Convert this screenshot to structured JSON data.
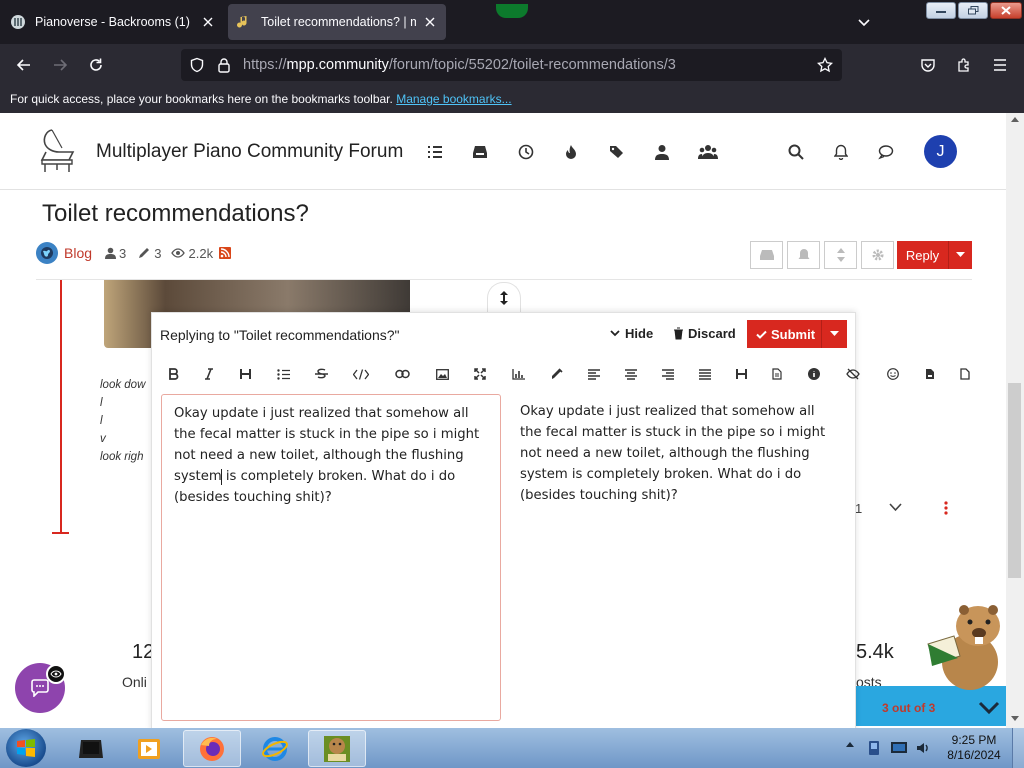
{
  "browser": {
    "tabs": [
      {
        "title": "Pianoverse - Backrooms (1)",
        "active": false
      },
      {
        "title": "Toilet recommendations? | mpp",
        "active": true
      }
    ],
    "url_prefix": "https://",
    "url_domain": "mpp.community",
    "url_path": "/forum/topic/55202/toilet-recommendations/3",
    "bookmark_hint": "For quick access, place your bookmarks here on the bookmarks toolbar.",
    "bookmark_link": "Manage bookmarks..."
  },
  "forum": {
    "site_name": "Multiplayer Piano Community Forum",
    "avatar_letter": "J",
    "nav_icons": [
      "list-icon",
      "inbox-icon",
      "clock-icon",
      "fire-icon",
      "tags-icon",
      "user-icon",
      "users-icon"
    ],
    "right_icons": [
      "search-icon",
      "bell-icon",
      "chat-icon"
    ]
  },
  "topic": {
    "title": "Toilet recommendations?",
    "category": "Blog",
    "posters": "3",
    "posts": "3",
    "views": "2.2k",
    "reply_label": "Reply"
  },
  "bg_post": {
    "lines": [
      "look dow",
      "l",
      "l",
      "v",
      "look righ"
    ],
    "stat_left": "12",
    "stat_left_label": "Onli",
    "stat_right": "5.4k",
    "stat_right_label": "osts",
    "counter": "1",
    "pager_text": "3 out of 3"
  },
  "composer": {
    "replying_to": "Replying to \"Toilet recommendations?\"",
    "hide_label": "Hide",
    "discard_label": "Discard",
    "submit_label": "Submit",
    "toolbar": [
      "bold-icon",
      "italic-icon",
      "heading-icon",
      "list-icon",
      "strikethrough-icon",
      "code-icon",
      "link-icon",
      "image-icon",
      "fullscreen-icon",
      "chart-icon",
      "color-icon",
      "align-left-icon",
      "align-center-icon",
      "align-right-icon",
      "align-justify-icon",
      "heading2-icon",
      "file-icon",
      "info-icon",
      "hidden-icon",
      "emoji-icon",
      "doc-icon",
      "page-icon"
    ],
    "editor_text": "Okay update i just realized that somehow all the fecal matter is stuck in the pipe so i might not need a new toilet, although the flushing system is completely broken. What do i do (besides touching shit)?",
    "preview_text": "Okay update i just realized that somehow all the fecal matter is stuck in the pipe so i might not need a new toilet, although the flushing system is completely broken. What do i do (besides touching shit)?"
  },
  "taskbar": {
    "time": "9:25 PM",
    "date": "8/16/2024",
    "apps": [
      "media-app",
      "video-app",
      "firefox-app",
      "ie-app",
      "beaver-box-app"
    ]
  },
  "colors": {
    "accent": "#d8281f",
    "avatar": "#1e40af",
    "chat_bubble": "#8e44ad",
    "link": "#4fc3f7"
  }
}
